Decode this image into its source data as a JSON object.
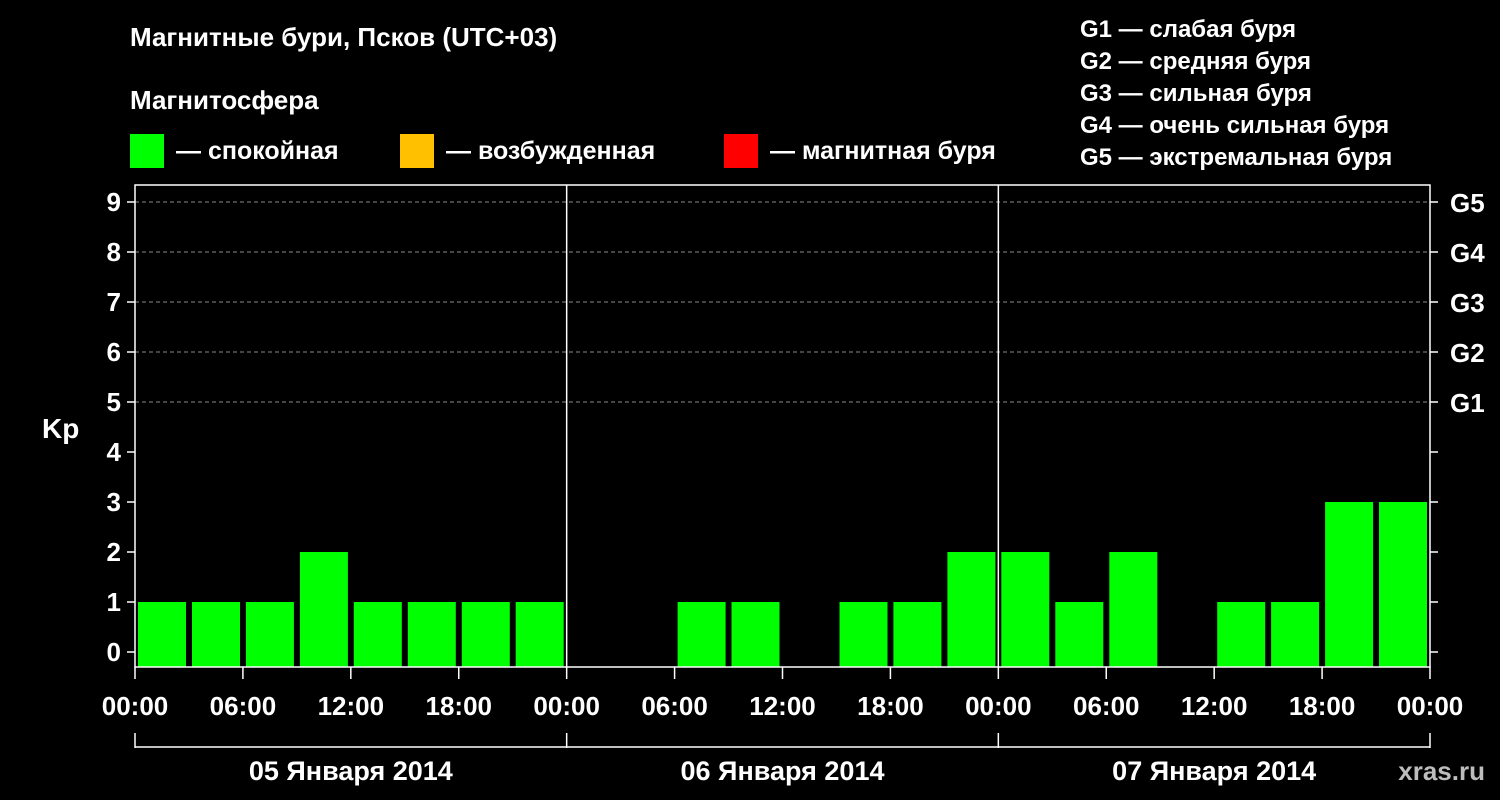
{
  "header": {
    "title": "Магнитные бури, Псков (UTC+03)",
    "subtitle": "Магнитосфера"
  },
  "legend": {
    "items": [
      {
        "label": "— спокойная",
        "color": "#00ff00"
      },
      {
        "label": "— возбужденная",
        "color": "#ffc000"
      },
      {
        "label": "— магнитная буря",
        "color": "#ff0000"
      }
    ]
  },
  "g_legend": [
    "G1 — слабая буря",
    "G2 — средняя буря",
    "G3 — сильная буря",
    "G4 — очень сильная буря",
    "G5 — экстремальная буря"
  ],
  "watermark": "xras.ru",
  "chart_data": {
    "type": "bar",
    "title": "Магнитные бури, Псков (UTC+03)",
    "ylabel": "Kp",
    "ylim": [
      0,
      9
    ],
    "y_ticks": [
      "0",
      "1",
      "2",
      "3",
      "4",
      "5",
      "6",
      "7",
      "8",
      "9"
    ],
    "right_ticks": [
      {
        "kp": 5,
        "label": "G1"
      },
      {
        "kp": 6,
        "label": "G2"
      },
      {
        "kp": 7,
        "label": "G3"
      },
      {
        "kp": 8,
        "label": "G4"
      },
      {
        "kp": 9,
        "label": "G5"
      }
    ],
    "x_tick_labels": [
      "00:00",
      "06:00",
      "12:00",
      "18:00",
      "00:00",
      "06:00",
      "12:00",
      "18:00",
      "00:00",
      "06:00",
      "12:00",
      "18:00",
      "00:00"
    ],
    "days": [
      "05 Января 2014",
      "06 Января 2014",
      "07 Января 2014"
    ],
    "interval_hours": 3,
    "grid": "dashed horizontal at Kp 5-9",
    "bar_color": "#00ff00",
    "values": [
      1,
      1,
      1,
      2,
      1,
      1,
      1,
      1,
      0,
      0,
      1,
      1,
      0,
      1,
      1,
      2,
      2,
      1,
      2,
      0,
      1,
      1,
      3,
      3
    ]
  }
}
